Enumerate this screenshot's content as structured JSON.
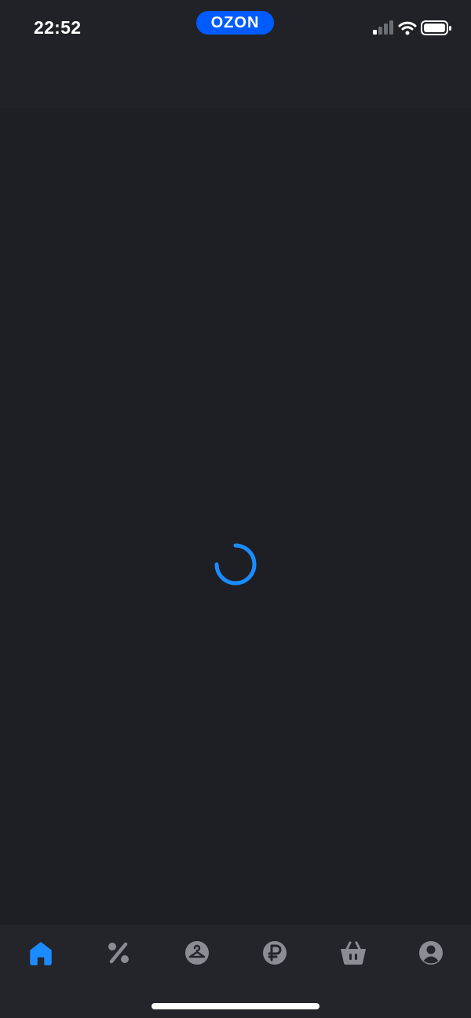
{
  "status_bar": {
    "time": "22:52",
    "battery_icon": "battery-full-icon",
    "signal_icon": "signal-bars-icon",
    "wifi_icon": "wifi-icon"
  },
  "app": {
    "logo_text": "OZON",
    "brand_color": "#005bff",
    "accent_color": "#1a8cff"
  },
  "content": {
    "loading_indicator": "spinner-icon"
  },
  "bottom_nav": {
    "items": [
      {
        "id": "home",
        "icon": "home-icon",
        "active": true
      },
      {
        "id": "discounts",
        "icon": "percent-icon",
        "active": false
      },
      {
        "id": "fresh",
        "icon": "hanger-icon",
        "active": false
      },
      {
        "id": "finance",
        "icon": "ruble-icon",
        "active": false
      },
      {
        "id": "cart",
        "icon": "basket-icon",
        "active": false
      },
      {
        "id": "profile",
        "icon": "profile-icon",
        "active": false
      }
    ]
  }
}
